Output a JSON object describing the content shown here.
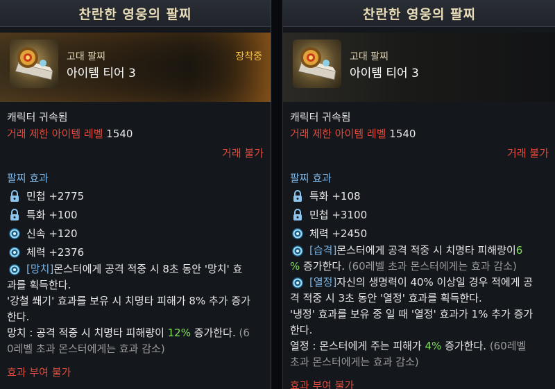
{
  "left": {
    "title": "찬란한 영웅의 팔찌",
    "category": "고대 팔찌",
    "tier": "아이템 티어 3",
    "equipped": "장착중",
    "bound": "캐릭터 귀속됨",
    "level_label": "거래 제한 아이템 레벨",
    "level_value": "1540",
    "trade": "거래 불가",
    "effects_title": "팔찌 효과",
    "stats": [
      {
        "icon": "lock-icon",
        "text": "민첩 +2775"
      },
      {
        "icon": "lock-icon",
        "text": "특화 +100"
      },
      {
        "icon": "swirl-icon",
        "text": "신속 +120"
      },
      {
        "icon": "swirl-icon",
        "text": "체력 +2376"
      }
    ],
    "effect_tag": "[망치]",
    "effect_line1_rest": " 몬스터에게 공격 적중 시 8초 동안 '망치' 효",
    "effect_line2": "과를 획득한다.",
    "effect_line3": "'강철 쐐기' 효과를 보유 시 치명타 피해가 8% 추가 증가",
    "effect_line4": "한다.",
    "effect_line5_pre": "망치 : 공격 적중 시 치명타 피해량이 ",
    "effect_line5_pct": "12%",
    "effect_line5_post": " 증가한다. ",
    "effect_line5_gray": "(6",
    "effect_line6_gray": "0레벨 초과 몬스터에게는 효과 감소)",
    "enchant": "효과 부여 불가"
  },
  "right": {
    "title": "찬란한 영웅의 팔찌",
    "category": "고대 팔찌",
    "tier": "아이템 티어 3",
    "bound": "캐릭터 귀속됨",
    "level_label": "거래 제한 아이템 레벨",
    "level_value": "1540",
    "trade": "거래 불가",
    "effects_title": "팔찌 효과",
    "stats": [
      {
        "icon": "lock-icon",
        "text": "특화 +108"
      },
      {
        "icon": "lock-icon",
        "text": "민첩 +3100"
      },
      {
        "icon": "swirl-icon",
        "text": "체력 +2450"
      }
    ],
    "e1_tag": "[습격]",
    "e1_rest": " 몬스터에게 공격 적중 시 치명타 피해량이 ",
    "e1_num": "6",
    "e1_line2_pct": "%",
    "e1_line2_mid": " 증가한다. ",
    "e1_line2_gray": "(60레벨 초과 몬스터에게는 효과 감소)",
    "e2_tag": "[열정]",
    "e2_rest": " 자신의 생명력이 40% 이상일 경우 적에게 공",
    "e2_line2": "격 적중 시 3초 동안 '열정' 효과를 획득한다.",
    "e2_line3": "'냉정' 효과를 보유 중 일 때 '열정' 효과가 1% 추가 증가",
    "e2_line4": "한다.",
    "e2_line5_pre": "열정 : 몬스터에게 주는 피해가 ",
    "e2_line5_pct": "4%",
    "e2_line5_post": " 증가한다. ",
    "e2_line5_gray": "(60레벨",
    "e2_line6_gray": "초과 몬스터에게는 효과 감소)",
    "enchant": "효과 부여 불가"
  }
}
